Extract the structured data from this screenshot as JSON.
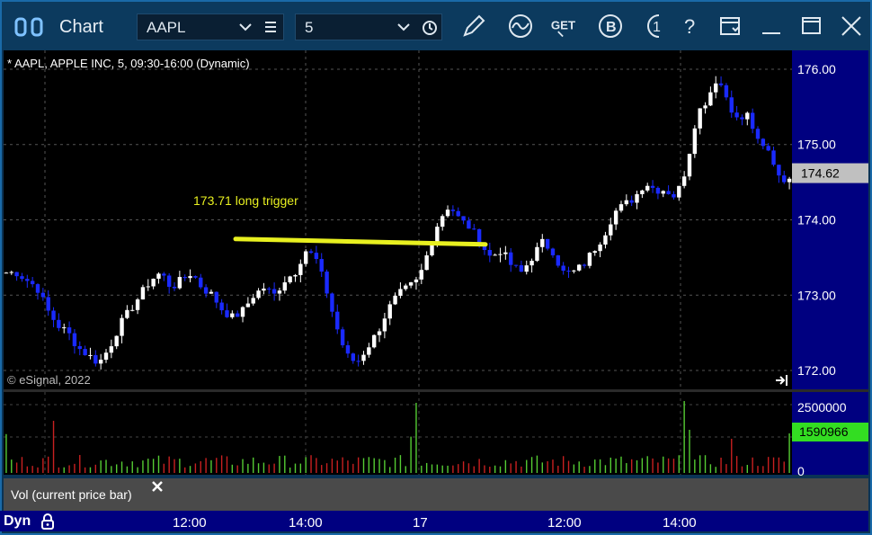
{
  "window": {
    "title": "Chart",
    "symbol_value": "AAPL",
    "interval_value": "5",
    "get_label": "GET",
    "colors": {
      "titlebar": "#0c3a5e",
      "axis": "#000080",
      "up": "#ffffff",
      "down": "#1a2aff",
      "trendline": "#e8f020",
      "annotation": "#e8f020",
      "vol_up": "#55cc33",
      "vol_down": "#c82020"
    }
  },
  "toolbar_icons": [
    "pencil-icon",
    "wave-icon",
    "get-data-icon",
    "b-icon",
    "info-icon",
    "help-icon",
    "window-menu-icon",
    "minimize-icon",
    "maximize-icon",
    "close-icon"
  ],
  "chart": {
    "study_header": "* AAPL, APPLE INC, 5, 09:30-16:00 (Dynamic)",
    "annotation": "173.71 long trigger",
    "copyright": "© eSignal, 2022",
    "last_price": "174.62",
    "price_ticks": [
      "176.00",
      "175.00",
      "174.00",
      "173.00",
      "172.00"
    ],
    "volume_ticks": [
      "2500000",
      "0"
    ],
    "last_volume": "1590966",
    "volume_legend": "Vol (current price bar)",
    "dyn_label": "Dyn",
    "time_ticks": [
      "12:00",
      "14:00",
      "17",
      "12:00",
      "14:00"
    ]
  },
  "chart_data": {
    "type": "candlestick",
    "symbol": "AAPL",
    "interval": "5",
    "ylim": [
      171.75,
      176.25
    ],
    "trendline": {
      "value": 173.71
    },
    "close_path": [
      173.3,
      173.3,
      173.2,
      173.1,
      172.8,
      172.6,
      172.5,
      172.3,
      172.2,
      172.1,
      172.3,
      172.6,
      172.8,
      173.0,
      173.2,
      173.3,
      173.1,
      173.2,
      173.3,
      173.1,
      173.0,
      172.8,
      172.7,
      172.8,
      173.0,
      173.1,
      173.0,
      173.2,
      173.3,
      173.6,
      173.5,
      173.1,
      172.6,
      172.2,
      172.1,
      172.3,
      172.5,
      172.8,
      173.0,
      173.1,
      173.2,
      173.6,
      174.0,
      174.2,
      174.0,
      173.9,
      173.7,
      173.5,
      173.6,
      173.4,
      173.3,
      173.5,
      173.7,
      173.6,
      173.3,
      173.3,
      173.4,
      173.6,
      173.8,
      174.1,
      174.2,
      174.3,
      174.5,
      174.4,
      174.4,
      174.3,
      174.7,
      175.4,
      175.6,
      175.9,
      175.6,
      175.3,
      175.4,
      175.0,
      174.9,
      174.6,
      174.5
    ]
  }
}
